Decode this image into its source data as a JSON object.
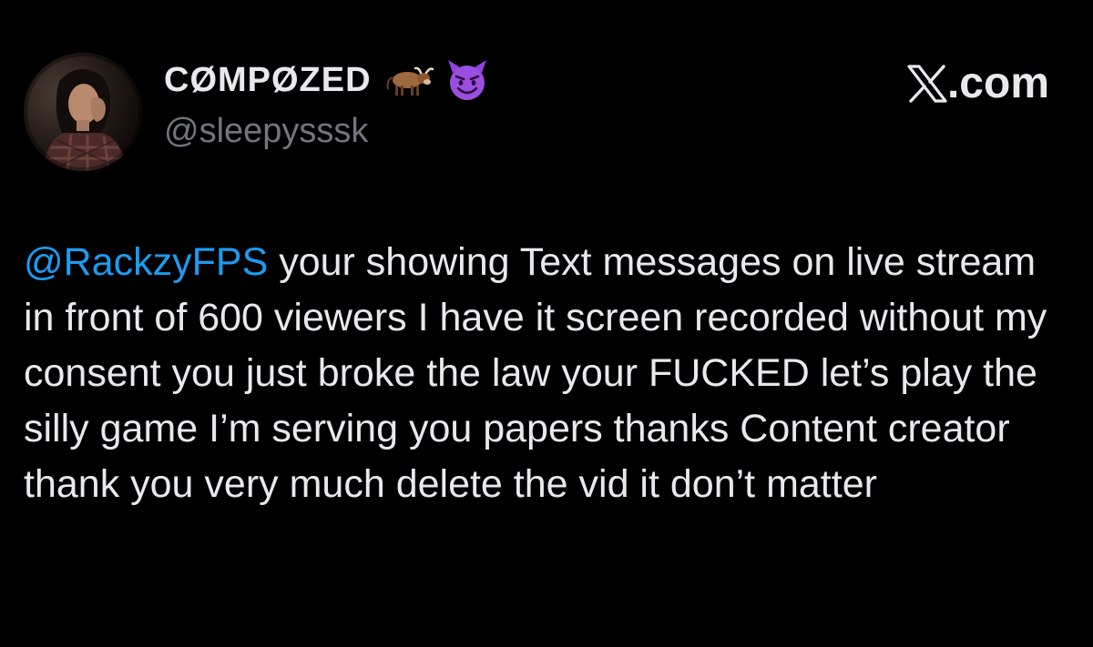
{
  "author": {
    "display_name": "CØMPØZED",
    "handle": "@sleepysssk",
    "avatar": "profile-photo",
    "name_emojis": [
      "ox-emoji",
      "smiling-devil-emoji"
    ]
  },
  "site": {
    "logo": "x-logo",
    "text": ".com"
  },
  "tweet": {
    "mention": "@RackzyFPS",
    "text": " your showing Text messages on live stream in front of 600 viewers I have it screen recorded without my consent you just broke the law your FUCKED let’s play the silly game I’m serving you papers thanks Content creator thank you very much delete the vid it don’t matter"
  },
  "colors": {
    "background": "#000000",
    "text": "#e7e9ea",
    "secondary_text": "#71767b",
    "link": "#1d9bf0"
  }
}
